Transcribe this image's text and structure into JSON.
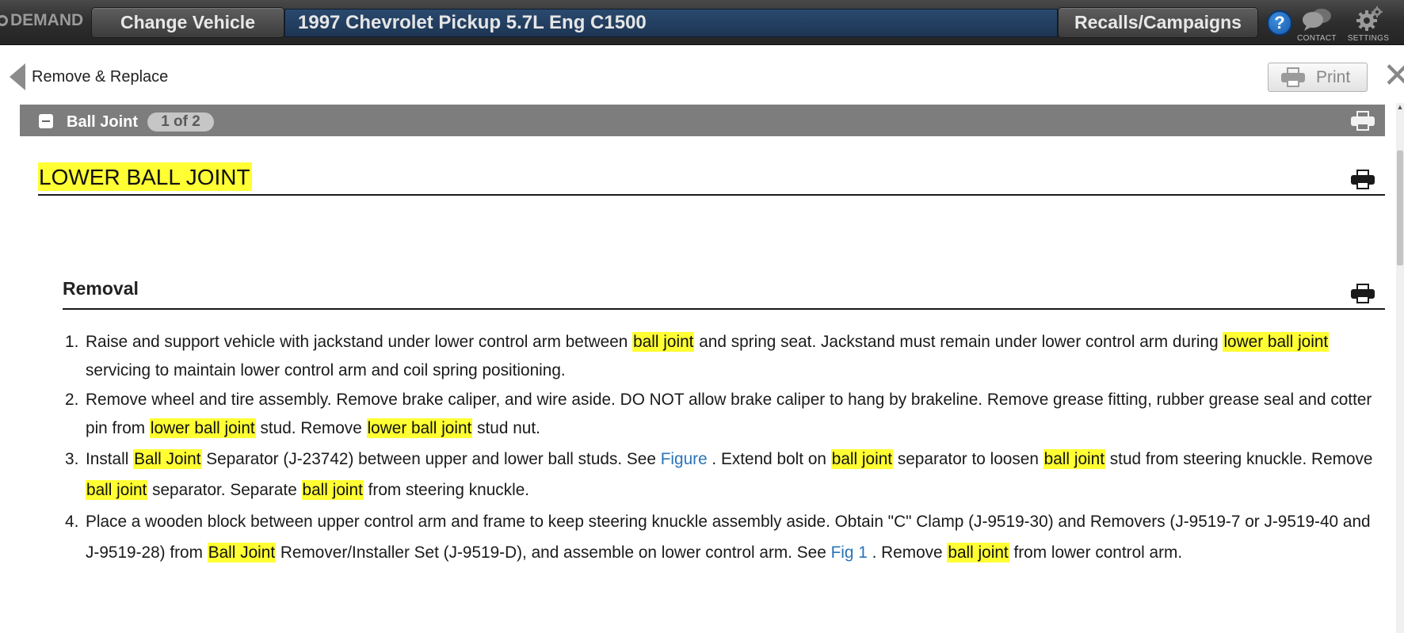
{
  "topbar": {
    "brand": "DEMAND",
    "change_vehicle": "Change Vehicle",
    "vehicle": "1997 Chevrolet Pickup 5.7L Eng C1500",
    "recalls": "Recalls/Campaigns",
    "help": "?",
    "contact": "CONTACT",
    "settings": "SETTINGS"
  },
  "subheader": {
    "back": "Remove & Replace",
    "print": "Print",
    "close": "✕"
  },
  "section": {
    "title": "Ball Joint",
    "pager": "1 of 2"
  },
  "doc": {
    "title": "LOWER BALL JOINT",
    "subtitle": "Removal",
    "steps": [
      {
        "num": "1.",
        "parts": [
          "Raise and support vehicle with jackstand under lower control arm between ",
          "ball joint",
          " and spring seat. Jackstand must remain under lower control arm during ",
          "lower ball joint",
          " servicing to maintain lower control arm and coil spring positioning."
        ]
      },
      {
        "num": "2.",
        "parts": [
          "Remove wheel and tire assembly. Remove brake caliper, and wire aside. DO NOT allow brake caliper to hang by brakeline. Remove grease fitting, rubber grease seal and cotter pin from ",
          "lower ball joint",
          " stud. Remove ",
          "lower ball joint",
          " stud nut."
        ]
      },
      {
        "num": "3.",
        "parts": [
          "Install ",
          "Ball Joint",
          " Separator (J-23742) between upper and lower ball studs. See ",
          "Figure",
          " . Extend bolt on ",
          "ball joint",
          " separator to loosen ",
          "ball joint",
          " stud from steering knuckle. Remove ",
          "ball joint",
          " separator. Separate ",
          "ball joint",
          " from steering knuckle."
        ]
      },
      {
        "num": "4.",
        "parts": [
          "Place a wooden block between upper control arm and frame to keep steering knuckle assembly aside. Obtain \"C\" Clamp (J-9519-30) and Removers (J-9519-7 or J-9519-40 and J-9519-28) from ",
          "Ball Joint",
          " Remover/Installer Set (J-9519-D), and assemble on lower control arm. See ",
          "Fig 1",
          " . Remove ",
          "ball joint",
          " from lower control arm."
        ]
      }
    ]
  },
  "colors": {
    "highlight": "#ffff33",
    "link": "#2a74b8",
    "section_bar": "#7d7d7d",
    "vehicle_field": "#1d3554"
  },
  "icons": [
    "gear-icon",
    "help-icon",
    "contact-icon",
    "settings-icon",
    "back-arrow-icon",
    "printer-icon",
    "close-icon",
    "collapse-icon"
  ]
}
